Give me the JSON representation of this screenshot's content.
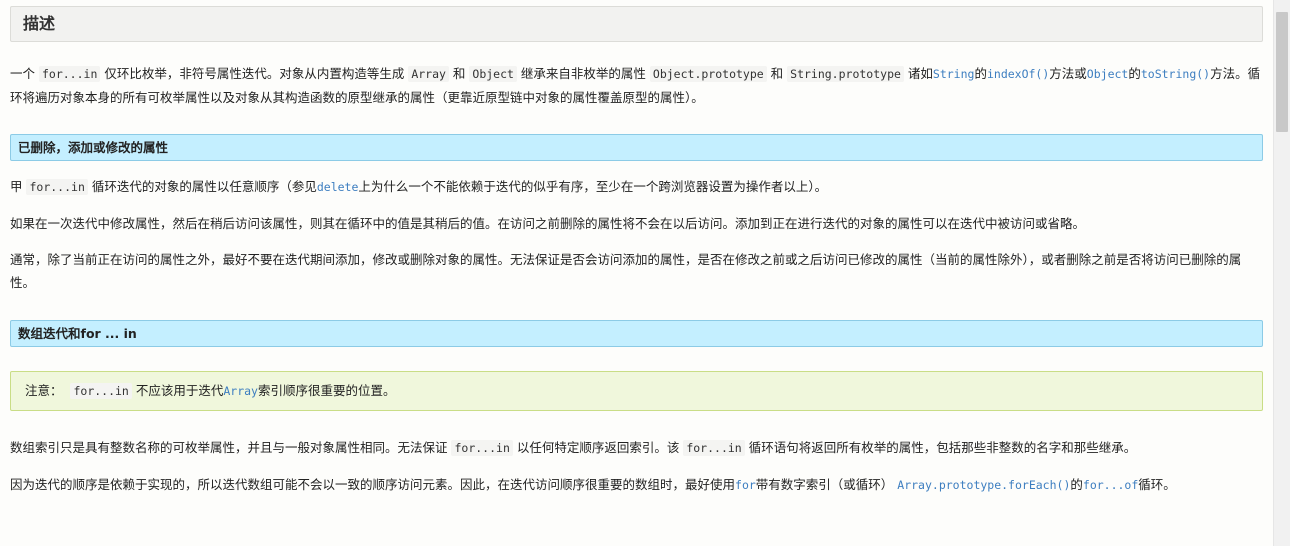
{
  "section_description": {
    "title": "描述",
    "p1": {
      "t1": "一个 ",
      "c1": "for...in",
      "t2": " 仅环比枚举，非符号属性迭代。对象从内置构造等生成 ",
      "c2": "Array",
      "t3": " 和 ",
      "c3": "Object",
      "t4": " 继承来自非枚举的属性 ",
      "c4": "Object.prototype",
      "t5": " 和 ",
      "c5": "String.prototype",
      "t6": " 诸如",
      "l1": "String",
      "t7": "的",
      "l2": "indexOf()",
      "t8": "方法或",
      "l3": "Object",
      "t9": "的",
      "l4": "toString()",
      "t10": "方法。循环将遍历对象本身的所有可枚举属性以及对象从其构造函数的原型继承的属性（更靠近原型链中对象的属性覆盖原型的属性）。"
    }
  },
  "section_deleted": {
    "title": "已删除，添加或修改的属性",
    "p1": {
      "t1": "甲 ",
      "c1": "for...in",
      "t2": " 循环迭代的对象的属性以任意顺序（参见",
      "l1": "delete",
      "t3": "上为什么一个不能依赖于迭代的似乎有序，至少在一个跨浏览器设置为操作者以上）。"
    },
    "p2": "如果在一次迭代中修改属性，然后在稍后访问该属性，则其在循环中的值是其稍后的值。在访问之前删除的属性将不会在以后访问。添加到正在进行迭代的对象的属性可以在迭代中被访问或省略。",
    "p3": "通常，除了当前正在访问的属性之外，最好不要在迭代期间添加，修改或删除对象的属性。无法保证是否会访问添加的属性，是否在修改之前或之后访问已修改的属性（当前的属性除外），或者删除之前是否将访问已删除的属性。"
  },
  "section_array": {
    "title": "数组迭代和for ... in",
    "note": {
      "label": "注意：",
      "c1": "for...in",
      "t1": " 不应该用于迭代",
      "l1": "Array",
      "t2": "索引顺序很重要的位置。"
    },
    "p1": {
      "t1": "数组索引只是具有整数名称的可枚举属性，并且与一般对象属性相同。无法保证 ",
      "c1": "for...in",
      "t2": " 以任何特定顺序返回索引。该 ",
      "c2": "for...in",
      "t3": " 循环语句将返回所有枚举的属性，包括那些非整数的名字和那些继承。"
    },
    "p2": {
      "t1": "因为迭代的顺序是依赖于实现的，所以迭代数组可能不会以一致的顺序访问元素。因此，在迭代访问顺序很重要的数组时，最好使用",
      "l1": "for",
      "t2": "带有数字索引（或循环） ",
      "l2": "Array.prototype.forEach()",
      "t3": "的",
      "l3": "for...of",
      "t4": "循环。"
    }
  },
  "colors": {
    "link": "#3d7ec0",
    "h3_background": "#c4efff",
    "note_background": "#f0f7dc"
  }
}
